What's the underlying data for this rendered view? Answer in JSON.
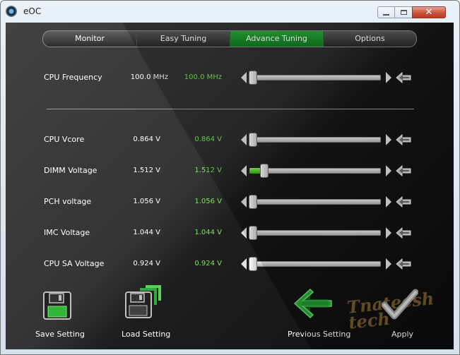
{
  "window": {
    "title": "eOC",
    "controls": {
      "minimize": "—",
      "maximize": "□",
      "close": "✕"
    }
  },
  "tabs": [
    {
      "label": "Monitor",
      "active": false
    },
    {
      "label": "Easy Tuning",
      "active": false
    },
    {
      "label": "Advance Tuning",
      "active": true
    },
    {
      "label": "Options",
      "active": false
    }
  ],
  "cpu_frequency": {
    "label": "CPU Frequency",
    "current": "100.0 MHz",
    "new": "100.0 MHz",
    "slider_level": 0.0
  },
  "voltages": [
    {
      "label": "CPU Vcore",
      "current": "0.864 V",
      "new": "0.864 V",
      "slider_level": 0.0
    },
    {
      "label": "DIMM Voltage",
      "current": "1.512 V",
      "new": "1.512 V",
      "slider_level": 0.09
    },
    {
      "label": "PCH voltage",
      "current": "1.056 V",
      "new": "1.056 V",
      "slider_level": 0.0
    },
    {
      "label": "IMC Voltage",
      "current": "1.044 V",
      "new": "1.044 V",
      "slider_level": 0.0
    },
    {
      "label": "CPU SA Voltage",
      "current": "0.924 V",
      "new": "0.924 V",
      "slider_level": 0.0
    }
  ],
  "actions": {
    "save_setting": "Save Setting",
    "load_setting": "Load Setting",
    "previous_setting": "Previous Setting",
    "apply": "Apply"
  },
  "watermark": "Tnateesh tech",
  "colors": {
    "accent_green": "#2aa63a",
    "value_green": "#7ae05a",
    "text": "#ffffff"
  },
  "icons": {
    "save": "floppy-disk-icon",
    "load": "floppy-disk-load-icon",
    "previous": "green-left-arrow-icon",
    "apply": "checkmark-icon",
    "reset": "reset-arrow-icon"
  }
}
